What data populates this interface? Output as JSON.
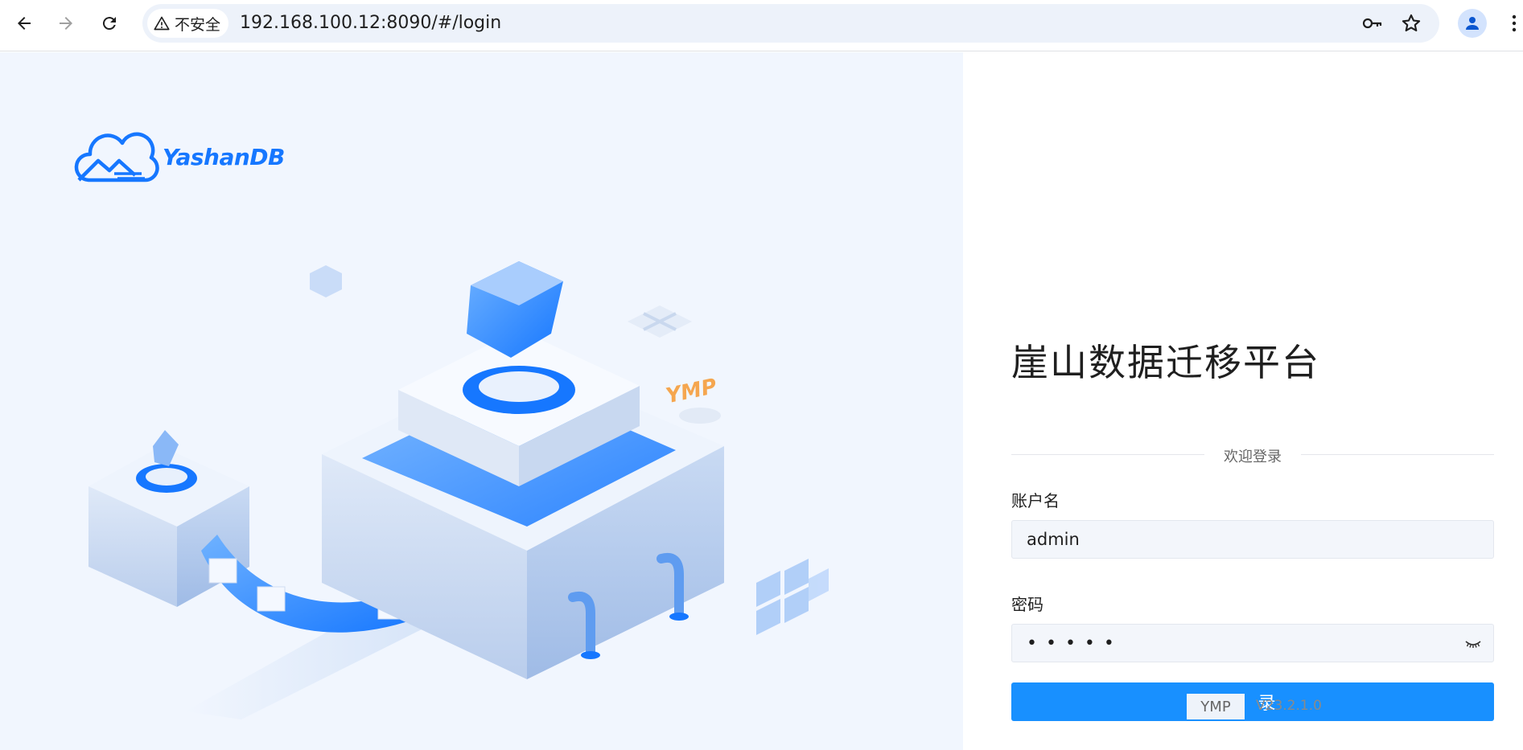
{
  "browser": {
    "security_label": "不安全",
    "url": "192.168.100.12:8090/#/login",
    "icons": [
      "back-icon",
      "forward-icon",
      "reload-icon",
      "warning-icon",
      "key-icon",
      "star-icon",
      "profile-icon",
      "menu-icon"
    ]
  },
  "brand": {
    "logo_text": "YashanDB",
    "hero_sign": "YMP",
    "accent_color": "#1677ff"
  },
  "login": {
    "title": "崖山数据迁移平台",
    "welcome": "欢迎登录",
    "username_label": "账户名",
    "username_value": "admin",
    "password_label": "密码",
    "password_mask": "•••••",
    "login_button": "登 录",
    "button_color": "#1890ff"
  },
  "footer": {
    "badge": "YMP",
    "version": "V23.2.1.0"
  }
}
